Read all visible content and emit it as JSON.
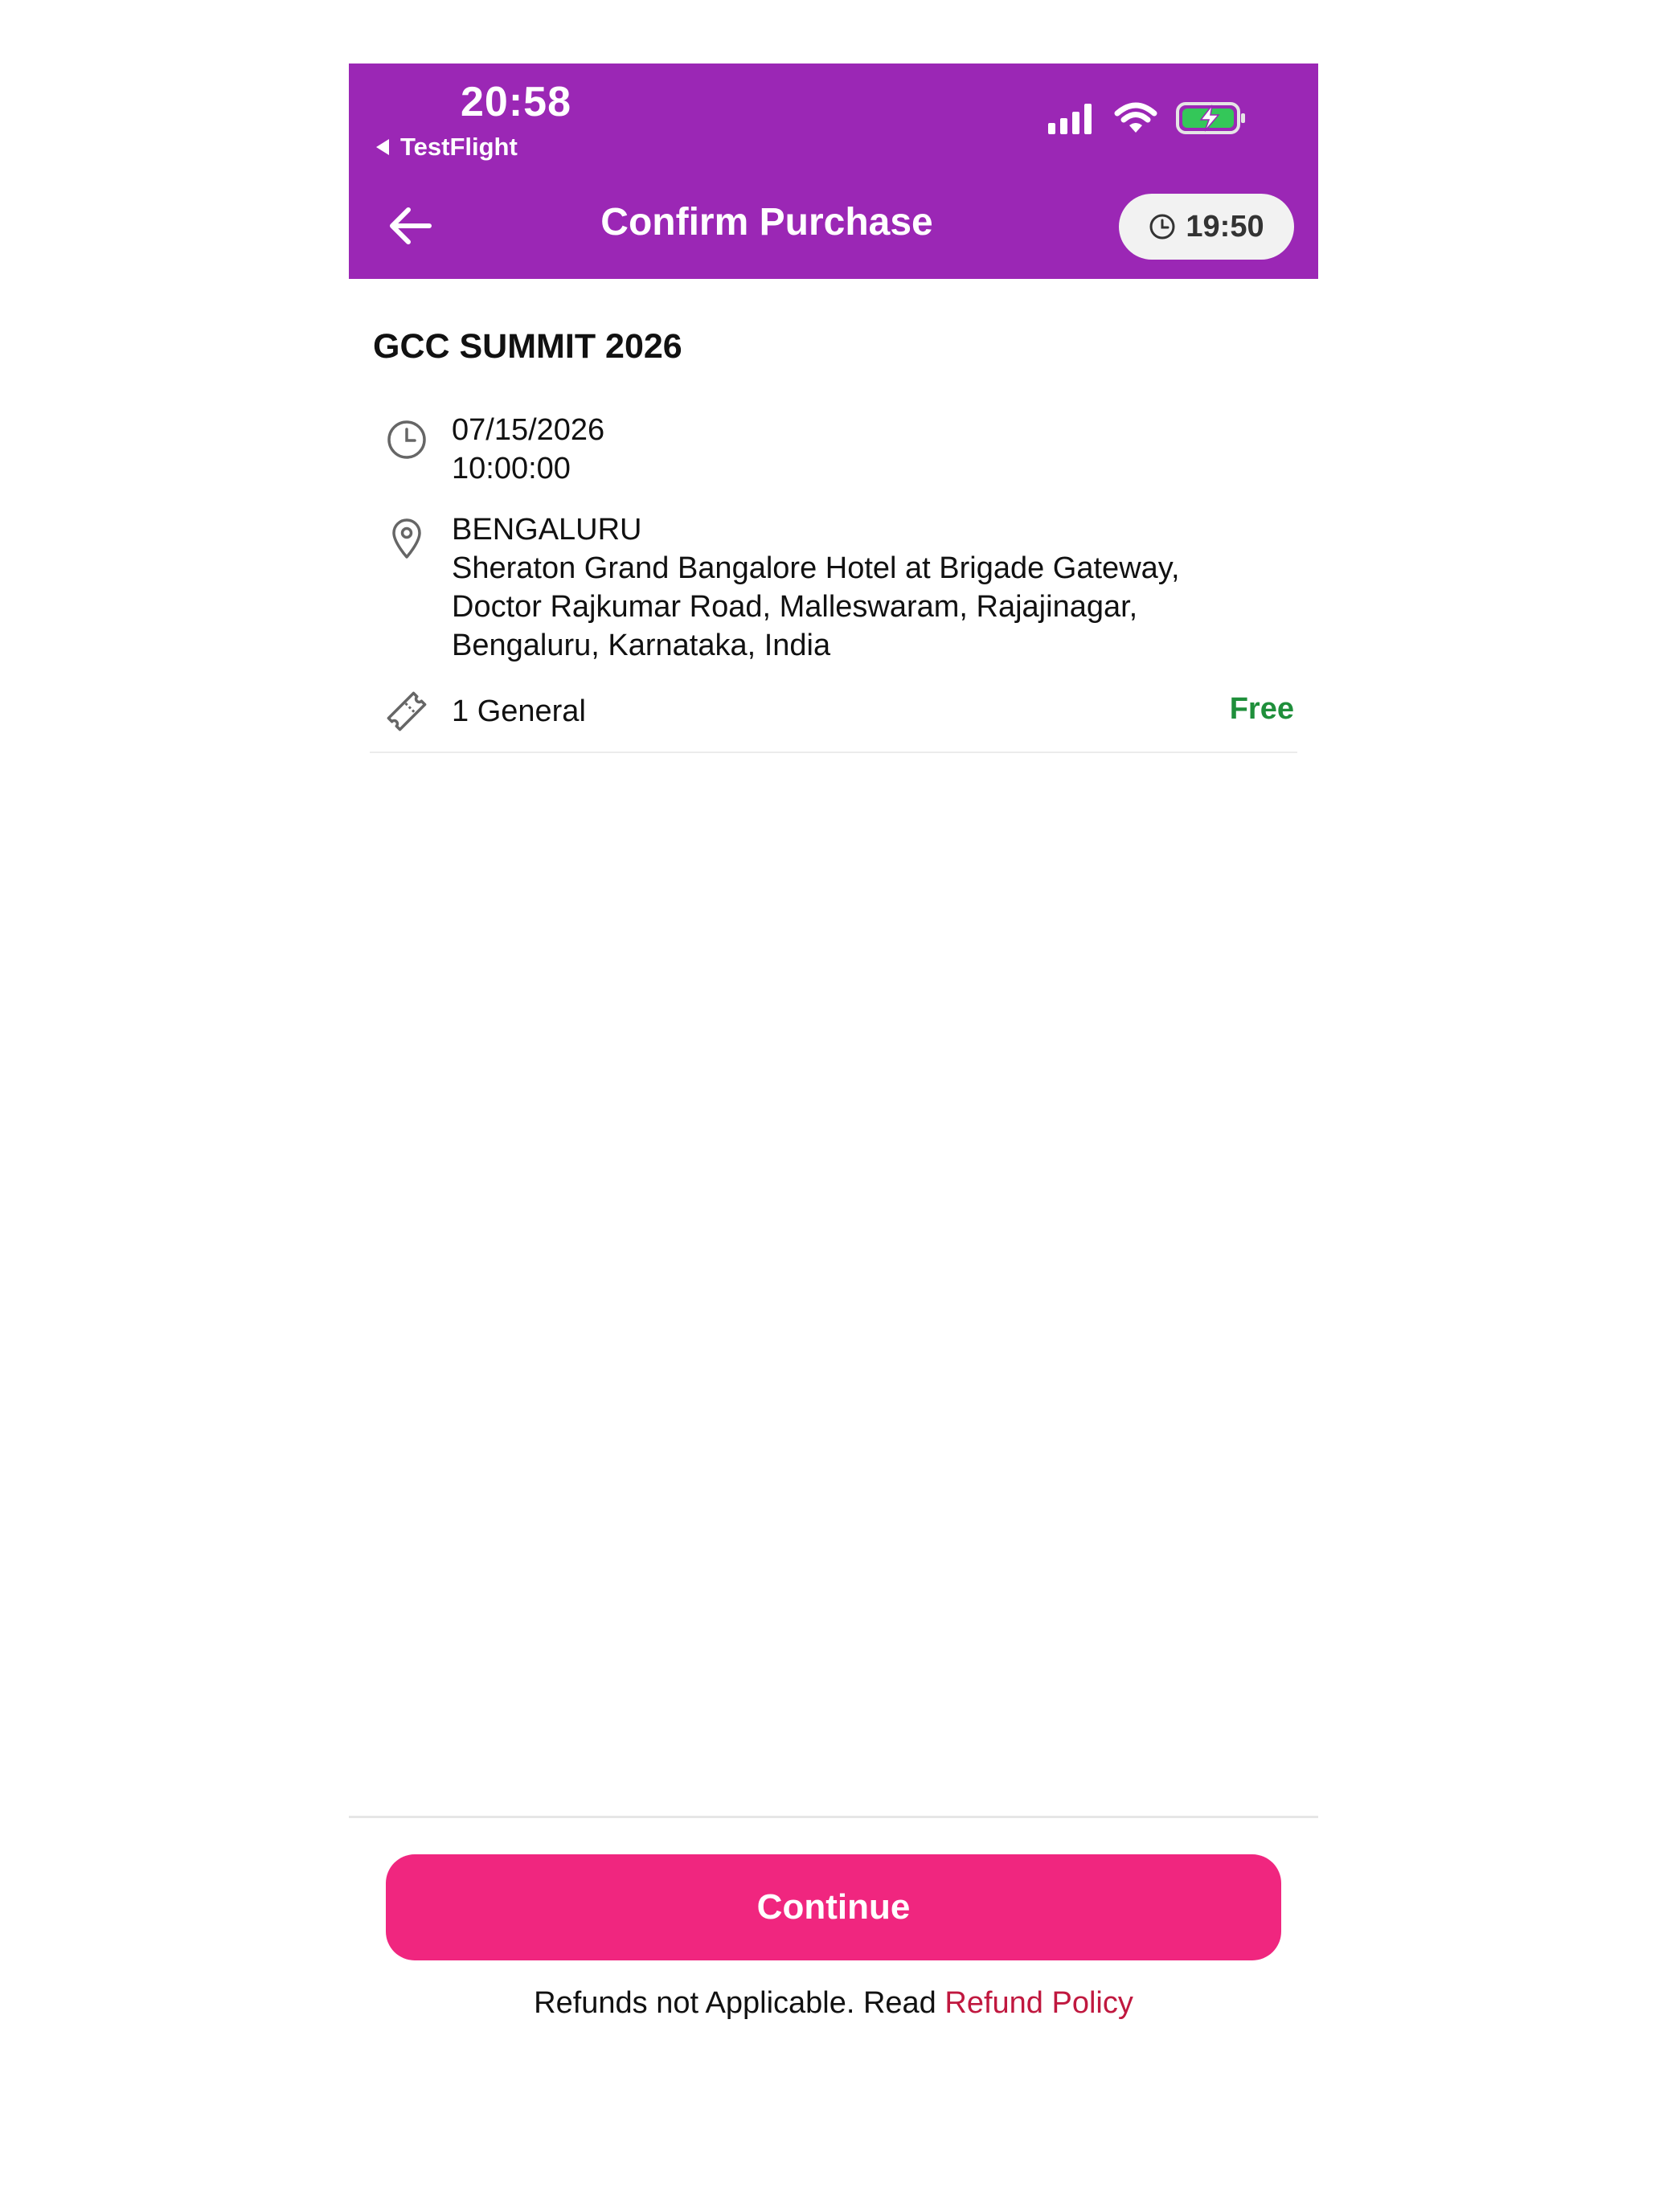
{
  "status_bar": {
    "time": "20:58",
    "back_app_label": "TestFlight"
  },
  "header": {
    "title": "Confirm Purchase",
    "timer": "19:50",
    "back_icon": "arrow-left-icon",
    "timer_icon": "clock-icon",
    "bg_color": "#9b27b5"
  },
  "event": {
    "title": "GCC SUMMIT 2026",
    "date": "07/15/2026",
    "time": "10:00:00",
    "city": "BENGALURU",
    "address_line1": "Sheraton Grand Bangalore Hotel at Brigade Gateway,",
    "address_line2": "Doctor Rajkumar Road, Malleswaram, Rajajinagar,",
    "address_line3": "Bengaluru, Karnataka, India",
    "ticket": "1 General",
    "price": "Free",
    "price_color": "#1f8f3b"
  },
  "footer": {
    "continue_label": "Continue",
    "continue_color": "#f0267f",
    "refund_text": "Refunds not Applicable. Read",
    "refund_link": "Refund Policy"
  }
}
